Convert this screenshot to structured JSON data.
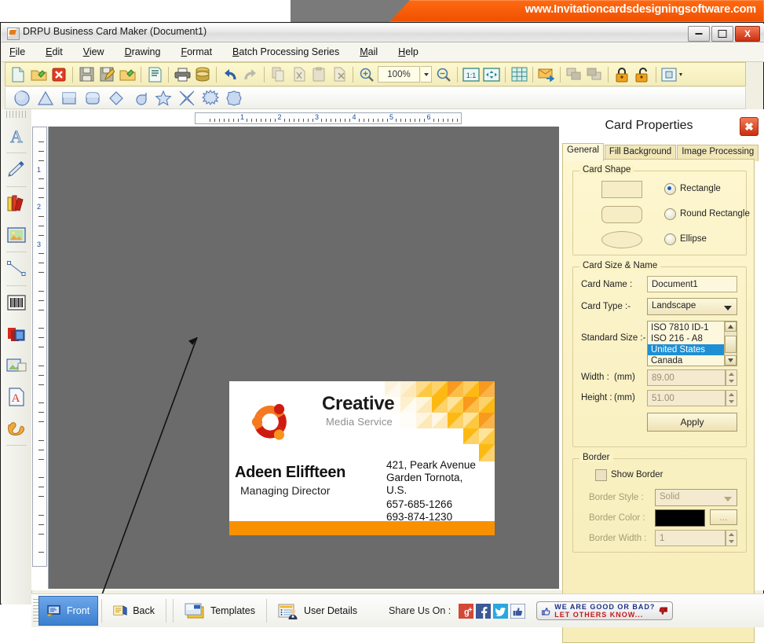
{
  "banner": {
    "url": "www.Invitationcardsdesigningsoftware.com"
  },
  "window": {
    "title": "DRPU Business Card Maker (Document1)",
    "minimize_label": "–",
    "maximize_label": "❐",
    "close_label": "X"
  },
  "menu": {
    "items": [
      {
        "label": "File",
        "accel": "F"
      },
      {
        "label": "Edit",
        "accel": "E"
      },
      {
        "label": "View",
        "accel": "V"
      },
      {
        "label": "Drawing",
        "accel": "D"
      },
      {
        "label": "Format",
        "accel": "F"
      },
      {
        "label": "Batch Processing Series",
        "accel": "B"
      },
      {
        "label": "Mail",
        "accel": "M"
      },
      {
        "label": "Help",
        "accel": "H"
      }
    ]
  },
  "toolbar": {
    "zoom_value": "100%",
    "buttons": [
      "new-document-icon",
      "open-folder-icon",
      "close-document-icon",
      "save-icon",
      "save-as-icon",
      "import-icon",
      "properties-icon",
      "print-icon",
      "database-icon",
      "undo-icon",
      "redo-icon",
      "copy-icon",
      "cut-icon",
      "paste-icon",
      "delete-icon",
      "zoom-in-icon",
      "zoom-out-icon",
      "actual-size-icon",
      "fit-page-icon",
      "grid-icon",
      "mail-icon",
      "bring-front-icon",
      "send-back-icon",
      "lock-icon",
      "unlock-icon",
      "align-icon"
    ],
    "shapes": [
      "ellipse-shape",
      "triangle-shape",
      "rectangle-shape",
      "rounded-rectangle-shape",
      "diamond-shape",
      "pie-shape",
      "star-shape",
      "four-point-star-shape",
      "explosion-shape",
      "polygon-shape"
    ]
  },
  "left_tools": [
    "text-tool-icon",
    "pencil-tool-icon",
    "barcode-library-icon",
    "image-tool-icon",
    "line-tool-icon",
    "barcode-tool-icon",
    "shape-layers-icon",
    "picture-frame-icon",
    "watermark-text-icon",
    "signature-tool-icon"
  ],
  "rulers": {
    "horizontal_numbers": [
      "1",
      "2",
      "3",
      "4",
      "5",
      "6"
    ],
    "vertical_numbers": [
      "1",
      "2",
      "3"
    ]
  },
  "card": {
    "title": "Creative",
    "subtitle": "Media Service",
    "name": "Adeen Eliffteen",
    "role": "Managing Director",
    "address_line1": "421, Peark Avenue",
    "address_line2": "Garden Tornota,",
    "address_line3": "U.S.",
    "phone1": "657-685-1266",
    "phone2": "693-874-1230",
    "accent_color": "#f99000",
    "logo_name": "creative-media-logo"
  },
  "properties": {
    "heading": "Card Properties",
    "close_label": "✖",
    "tabs": [
      {
        "label": "General",
        "active": true
      },
      {
        "label": "Fill Background",
        "active": false
      },
      {
        "label": "Image Processing",
        "active": false
      }
    ],
    "card_shape": {
      "group_label": "Card Shape",
      "options": [
        {
          "label": "Rectangle",
          "selected": true
        },
        {
          "label": "Round Rectangle",
          "selected": false
        },
        {
          "label": "Ellipse",
          "selected": false
        }
      ]
    },
    "card_size": {
      "group_label": "Card Size & Name",
      "card_name_label": "Card Name :",
      "card_name_value": "Document1",
      "card_type_label": "Card Type :-",
      "card_type_value": "Landscape",
      "standard_size_label": "Standard Size :-",
      "standard_size_options": [
        "ISO 7810 ID-1",
        "ISO 216 - A8",
        "United States",
        "Canada"
      ],
      "standard_size_selected": "United States",
      "width_label": "Width :",
      "width_unit": "(mm)",
      "width_value": "89.00",
      "height_label": "Height :",
      "height_unit": "(mm)",
      "height_value": "51.00",
      "apply_label": "Apply"
    },
    "border": {
      "group_label": "Border",
      "show_border_label": "Show Border",
      "show_border_checked": false,
      "style_label": "Border Style :",
      "style_value": "Solid",
      "color_label": "Border Color :",
      "color_value": "#000000",
      "color_browse_label": "...",
      "width_label": "Border Width :",
      "width_value": "1"
    }
  },
  "bottom": {
    "tabs": [
      {
        "label": "Front",
        "icon": "card-front-icon",
        "selected": true
      },
      {
        "label": "Back",
        "icon": "card-back-icon",
        "selected": false
      },
      {
        "label": "Templates",
        "icon": "templates-icon",
        "selected": false
      },
      {
        "label": "User Details",
        "icon": "user-details-icon",
        "selected": false
      }
    ],
    "share_label": "Share Us On :",
    "share_icons": [
      "google-plus-icon",
      "facebook-icon",
      "twitter-icon",
      "thumbs-up-icon"
    ],
    "rate_line1": "WE  ARE  GOOD  OR  BAD?",
    "rate_line2": "LET OTHERS KNOW..."
  }
}
